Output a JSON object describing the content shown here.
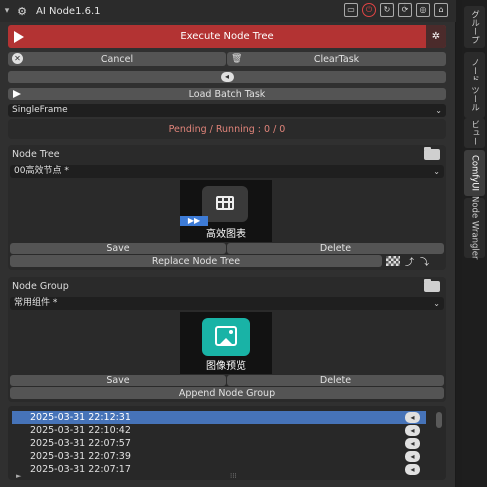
{
  "header": {
    "title": "AI Node1.6.1",
    "icons": [
      "screen-icon",
      "power-icon",
      "refresh-icon",
      "sync-icon",
      "globe-icon",
      "home-icon"
    ]
  },
  "toolbar": {
    "execute_label": "Execute Node Tree",
    "cancel_label": "Cancel",
    "clear_label": "ClearTask",
    "load_batch_label": "Load Batch Task"
  },
  "mode": {
    "value": "SingleFrame"
  },
  "status": {
    "text": "Pending / Running : 0 / 0",
    "color": "#e0847a"
  },
  "node_tree": {
    "header": "Node Tree",
    "selected": "00高效节点 *",
    "preview_label": "高效图表",
    "save_label": "Save",
    "delete_label": "Delete",
    "replace_label": "Replace Node Tree"
  },
  "node_group": {
    "header": "Node Group",
    "selected": "常用组件 *",
    "preview_label": "图像预览",
    "save_label": "Save",
    "delete_label": "Delete",
    "append_label": "Append Node Group"
  },
  "history": {
    "items": [
      "2025-03-31 22:12:31",
      "2025-03-31 22:10:42",
      "2025-03-31 22:07:57",
      "2025-03-31 22:07:39",
      "2025-03-31 22:07:17"
    ],
    "selected_index": 0
  },
  "sidebar": {
    "tabs": [
      "グループ",
      "ノード",
      "ツール",
      "ビュー",
      "ComfyUI",
      "Node Wrangler"
    ],
    "active": "ComfyUI"
  },
  "colors": {
    "accent": "#b33333",
    "selection": "#4673b8",
    "teal": "#19b3a6"
  }
}
